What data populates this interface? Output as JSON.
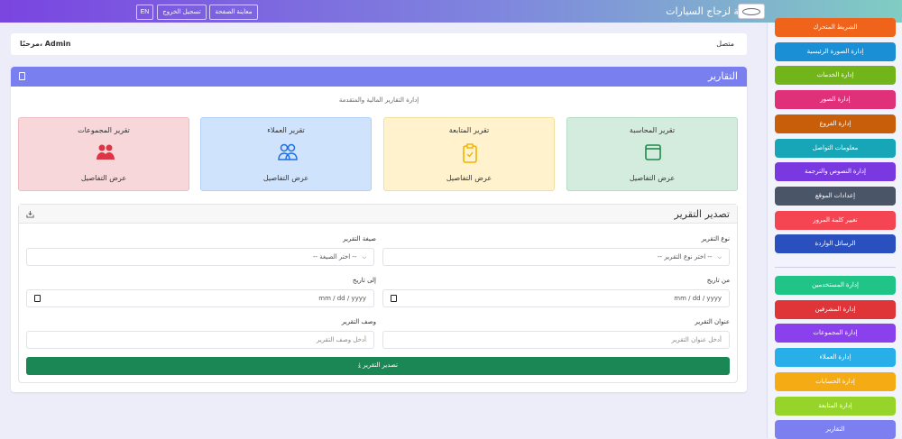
{
  "header": {
    "brand": "السلامة لزجاج السيارات",
    "preview": "معاينة الصفحة",
    "logout": "تسجيل الخروج",
    "lang": "EN"
  },
  "welcome": {
    "greeting": "مرحبًا، Admin",
    "status": "متصل"
  },
  "sidebar": {
    "group1": [
      {
        "label": "الشريط المتحرك",
        "color": "#f0631a"
      },
      {
        "label": "إدارة الصورة الرئيسية",
        "color": "#1a8fd6"
      },
      {
        "label": "إدارة الخدمات",
        "color": "#72b51a"
      },
      {
        "label": "إدارة الصور",
        "color": "#e0307a"
      },
      {
        "label": "إدارة الفروع",
        "color": "#c95e0a"
      },
      {
        "label": "معلومات التواصل",
        "color": "#17a5b8"
      },
      {
        "label": "إدارة النصوص والترجمة",
        "color": "#7a38e0"
      },
      {
        "label": "إعدادات الموقع",
        "color": "#4a5568"
      },
      {
        "label": "تغيير كلمة المرور",
        "color": "#f54452"
      },
      {
        "label": "الرسائل الواردة",
        "color": "#2a4fbf"
      }
    ],
    "group2": [
      {
        "label": "إدارة المستخدمين",
        "color": "#20c486"
      },
      {
        "label": "إدارة المشرفين",
        "color": "#e03538"
      },
      {
        "label": "إدارة المجموعات",
        "color": "#8a40ec"
      },
      {
        "label": "إدارة العملاء",
        "color": "#28aee8"
      },
      {
        "label": "إدارة الحسابات",
        "color": "#f5ab14"
      },
      {
        "label": "إدارة المتابعة",
        "color": "#96d42a"
      },
      {
        "label": "التقارير",
        "color": "#7b7ff0"
      }
    ]
  },
  "reports": {
    "title": "التقارير",
    "subtitle": "إدارة التقارير المالية والمتقدمة",
    "cards": [
      {
        "title": "تقرير المحاسبة",
        "link": "عرض التفاصيل",
        "icon": "wallet-icon"
      },
      {
        "title": "تقرير المتابعة",
        "link": "عرض التفاصيل",
        "icon": "clipboard-check-icon"
      },
      {
        "title": "تقرير العملاء",
        "link": "عرض التفاصيل",
        "icon": "people-icon"
      },
      {
        "title": "تقرير المجموعات",
        "link": "عرض التفاصيل",
        "icon": "people-fill-icon"
      }
    ]
  },
  "export": {
    "title": "تصدير التقرير",
    "type_label": "نوع التقرير",
    "type_value": "-- اختر نوع التقرير --",
    "format_label": "صيغة التقرير",
    "format_value": "-- اختر الصيغة --",
    "from_label": "من تاريخ",
    "from_value": "mm / dd / yyyy",
    "to_label": "إلى تاريخ",
    "to_value": "mm / dd / yyyy",
    "title_label": "عنوان التقرير",
    "title_placeholder": "أدخل عنوان التقرير",
    "desc_label": "وصف التقرير",
    "desc_placeholder": "أدخل وصف التقرير",
    "submit": "تصدير التقرير"
  }
}
